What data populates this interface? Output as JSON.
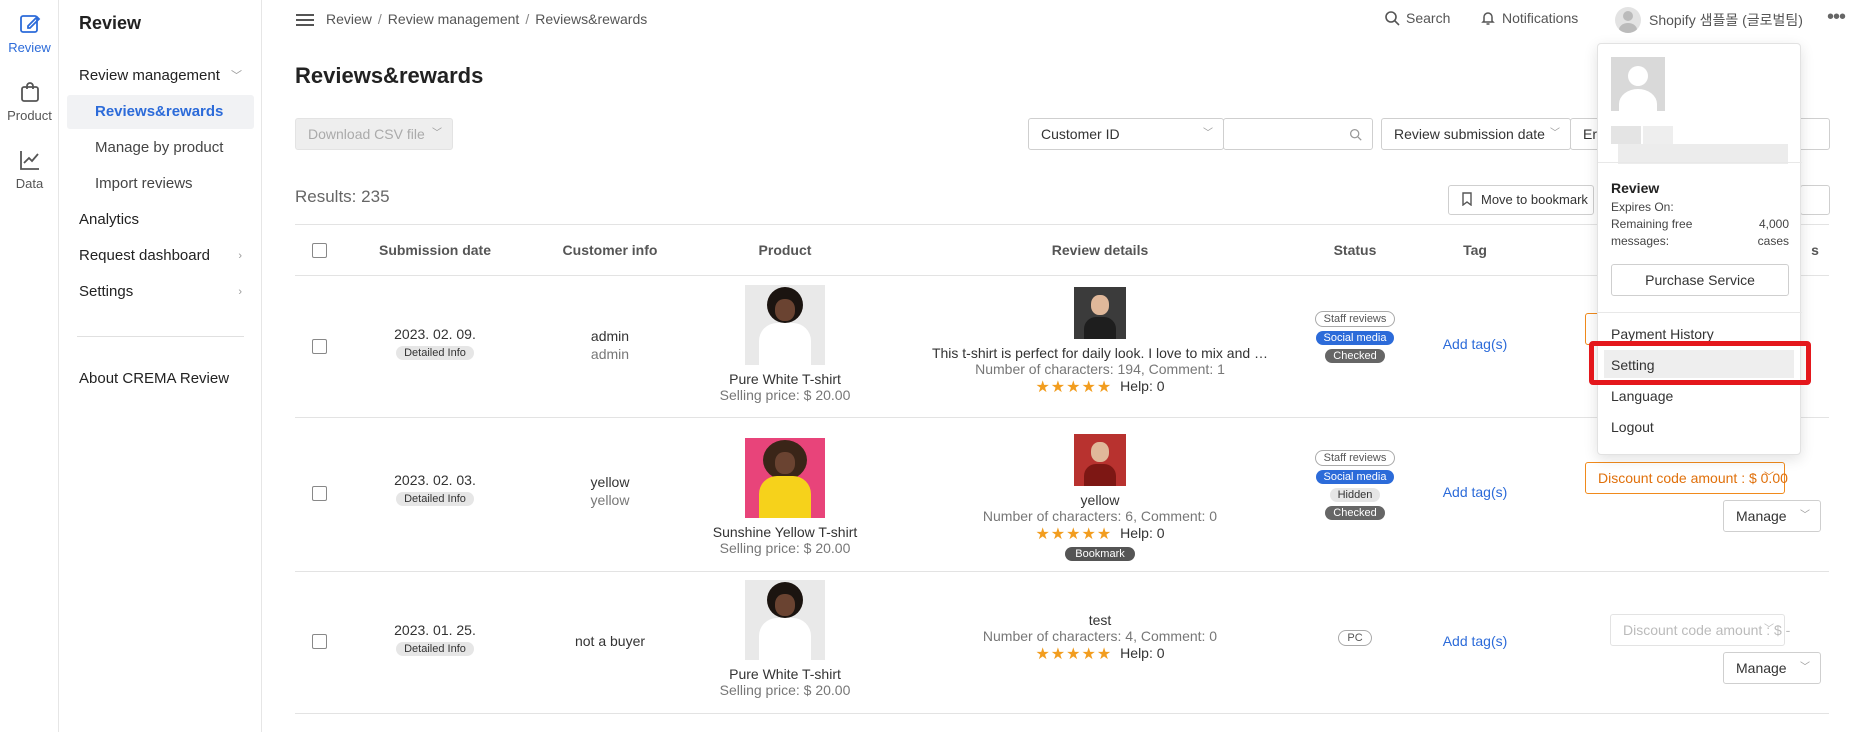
{
  "rail": {
    "items": [
      {
        "label": "Review",
        "icon": "edit-icon"
      },
      {
        "label": "Product",
        "icon": "bag-icon"
      },
      {
        "label": "Data",
        "icon": "chart-icon"
      }
    ]
  },
  "sidebar": {
    "title": "Review",
    "items": [
      {
        "label": "Review management"
      },
      {
        "label": "Reviews&rewards"
      },
      {
        "label": "Manage by product"
      },
      {
        "label": "Import reviews"
      },
      {
        "label": "Analytics"
      },
      {
        "label": "Request dashboard"
      },
      {
        "label": "Settings"
      }
    ],
    "about": "About CREMA Review"
  },
  "header": {
    "breadcrumb": [
      "Review",
      "Review management",
      "Reviews&rewards"
    ],
    "search": "Search",
    "notifications": "Notifications",
    "store": "Shopify 샘플몰 (글로벌팀)"
  },
  "page": {
    "title": "Reviews&rewards",
    "download": "Download CSV file",
    "customer_select": "Customer ID",
    "date_select": "Review submission date",
    "date_end_partial": "Er",
    "results_label": "Results:",
    "results_count": "235",
    "move_bookmark": "Move to bookmark"
  },
  "table": {
    "headers": [
      "Submission date",
      "Customer info",
      "Product",
      "Review details",
      "Status",
      "Tag",
      "s"
    ],
    "rows": [
      {
        "date": "2023. 02. 09.",
        "detail_btn": "Detailed Info",
        "customer1": "admin",
        "customer2": "admin",
        "product": "Pure White T-shirt",
        "price": "Selling price: $ 20.00",
        "review": "This t-shirt is perfect for daily look. I love to mix and …",
        "meta": "Number of characters: 194, Comment: 1",
        "stars": "★★★★★",
        "help": "Help: 0",
        "status": [
          "Staff reviews",
          "Social media",
          "Checked"
        ],
        "tag": "Add tag(s)"
      },
      {
        "date": "2023. 02. 03.",
        "detail_btn": "Detailed Info",
        "customer1": "yellow",
        "customer2": "yellow",
        "product": "Sunshine Yellow T-shirt",
        "price": "Selling price: $ 20.00",
        "review": "yellow",
        "meta": "Number of characters: 6, Comment: 0",
        "stars": "★★★★★",
        "help": "Help: 0",
        "bookmark": "Bookmark",
        "status": [
          "Staff reviews",
          "Social media",
          "Hidden",
          "Checked"
        ],
        "tag": "Add tag(s)",
        "discount": "Discount code amount : $ 0.00",
        "manage": "Manage"
      },
      {
        "date": "2023. 01. 25.",
        "detail_btn": "Detailed Info",
        "customer1": "not a buyer",
        "product": "Pure White T-shirt",
        "price": "Selling price: $ 20.00",
        "review": "test",
        "meta": "Number of characters: 4, Comment: 0",
        "stars": "★★★★★",
        "help": "Help: 0",
        "status": [
          "PC"
        ],
        "tag": "Add tag(s)",
        "discount": "Discount code amount : $ -",
        "manage": "Manage"
      }
    ]
  },
  "dropdown": {
    "plan_title": "Review",
    "expires": "Expires On:",
    "remaining_label": "Remaining free messages:",
    "remaining_value": "4,000 cases",
    "purchase": "Purchase Service",
    "payment_history": "Payment History",
    "setting": "Setting",
    "language": "Language",
    "logout": "Logout"
  },
  "colors": {
    "accent": "#2c6bd9",
    "orange": "#f08a1c",
    "highlight": "#e4171c",
    "star": "#f29d1f"
  }
}
